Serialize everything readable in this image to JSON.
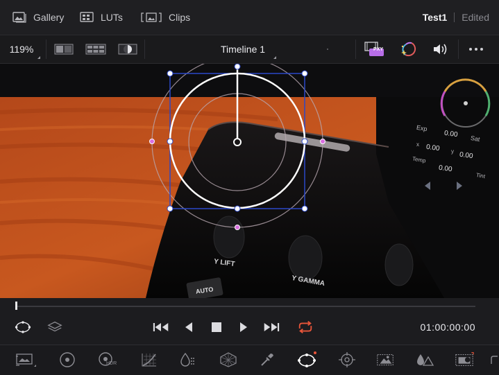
{
  "nav": {
    "gallery_label": "Gallery",
    "luts_label": "LUTs",
    "clips_label": "Clips"
  },
  "project": {
    "name": "Test1",
    "status": "Edited"
  },
  "toolbar": {
    "zoom": "119%",
    "timeline_title": "Timeline 1",
    "proxy_badge": "PXY"
  },
  "viewer": {
    "device_labels": {
      "y_lift": "Y LIFT",
      "y_gamma": "Y GAMMA",
      "auto": "AUTO",
      "exp": "Exp",
      "exp_value": "0.00",
      "sat": "Sat",
      "x_label": "x",
      "x_value": "0.00",
      "y_label": "y",
      "y_value": "0.00",
      "temp": "Temp",
      "temp_value": "0.00",
      "tint": "Tint"
    }
  },
  "transport": {
    "timecode": "01:00:00:00",
    "loop_color": "#e8553a"
  },
  "palette": {
    "hdr_badge": "HDR",
    "active_tool": "power-window"
  },
  "colors": {
    "accent_purple": "#c27cf5",
    "window_handle": "#d96fe0",
    "bbox_blue": "#2b48c8"
  }
}
